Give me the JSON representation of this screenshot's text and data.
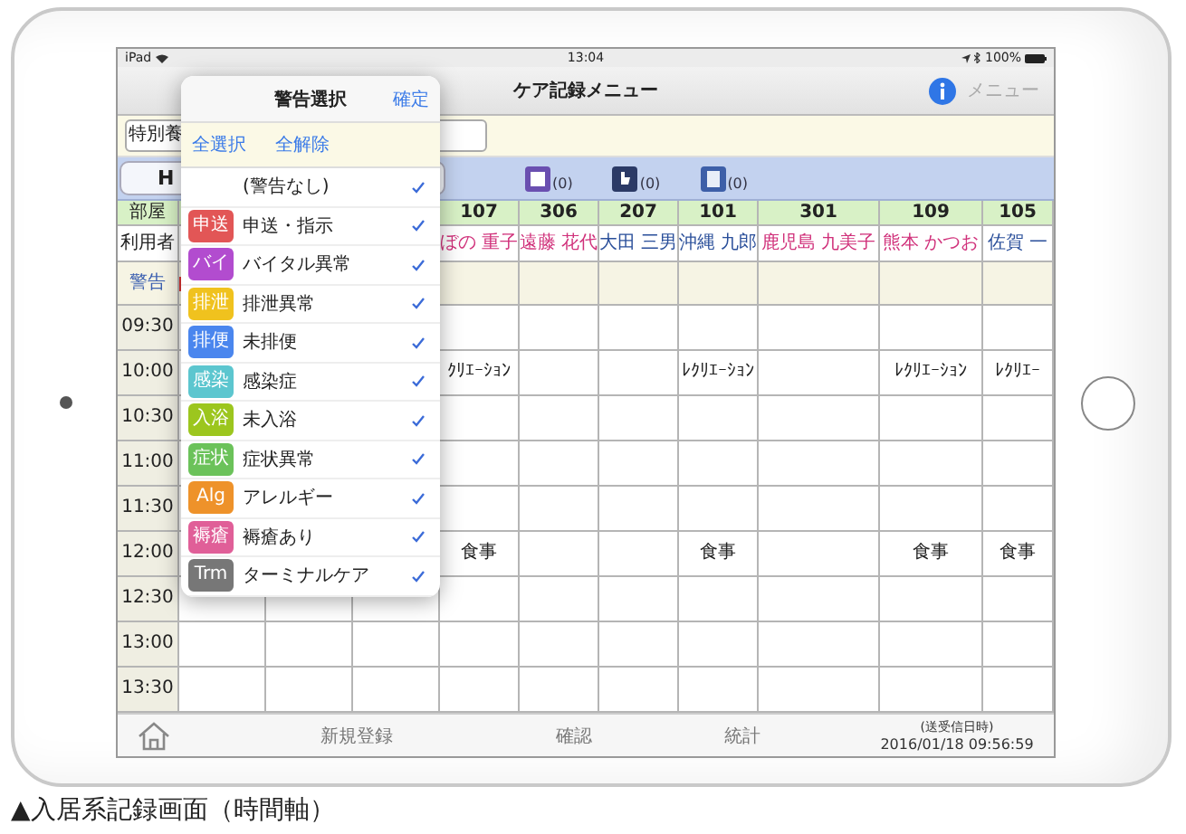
{
  "status_bar": {
    "carrier": "iPad",
    "time": "13:04",
    "battery": "100%"
  },
  "nav": {
    "title": "ケア記録メニュー",
    "menu": "メニュー"
  },
  "filter": {
    "value": "特別養"
  },
  "toolbar": {
    "button": "H",
    "counters": [
      {
        "kind": "note",
        "count": "(0)"
      },
      {
        "kind": "hand",
        "count": "(0)"
      },
      {
        "kind": "document",
        "count": "(0)"
      }
    ]
  },
  "table": {
    "room_label": "部屋",
    "user_label": "利用者",
    "warning_label": "警告",
    "rooms": [
      {
        "room": "107",
        "name": "ぼの 重子",
        "color": "#d0307a"
      },
      {
        "room": "306",
        "name": "遠藤 花代",
        "color": "#d0307a"
      },
      {
        "room": "207",
        "name": "大田 三男",
        "color": "#2a4f9a"
      },
      {
        "room": "101",
        "name": "沖縄 九郎",
        "color": "#2a4f9a"
      },
      {
        "room": "301",
        "name": "鹿児島 九美子",
        "color": "#d0307a"
      },
      {
        "room": "109",
        "name": "熊本 かつお",
        "color": "#d0307a"
      },
      {
        "room": "105",
        "name": "佐賀 一",
        "color": "#2a4f9a"
      }
    ],
    "rows": [
      {
        "time": "09:30",
        "cells": [
          {},
          {},
          {},
          {},
          {},
          {},
          {}
        ]
      },
      {
        "time": "10:00",
        "cells": [
          {
            "text": "ｸﾘｴｰｼｮﾝ"
          },
          {},
          {},
          {
            "text": "ﾚｸﾘｴｰｼｮﾝ"
          },
          {},
          {
            "text": "ﾚｸﾘｴｰｼｮﾝ"
          },
          {
            "text": "ﾚｸﾘｴｰ"
          }
        ]
      },
      {
        "time": "10:30",
        "cells": [
          {},
          {},
          {},
          {},
          {},
          {},
          {}
        ]
      },
      {
        "time": "11:00",
        "cells": [
          {},
          {},
          {},
          {},
          {},
          {},
          {}
        ]
      },
      {
        "time": "11:30",
        "cells": [
          {},
          {},
          {},
          {},
          {},
          {},
          {}
        ]
      },
      {
        "time": "12:00",
        "cells": [
          {
            "text": "食事"
          },
          {},
          {},
          {
            "text": "食事"
          },
          {},
          {
            "text": "食事"
          },
          {
            "text": "食事"
          }
        ]
      },
      {
        "time": "12:30",
        "cells": [
          {},
          {},
          {},
          {},
          {},
          {},
          {}
        ]
      },
      {
        "time": "13:00",
        "cells": [
          {},
          {},
          {},
          {},
          {},
          {},
          {}
        ]
      },
      {
        "time": "13:30",
        "cells": [
          {},
          {},
          {},
          {},
          {},
          {},
          {}
        ]
      }
    ]
  },
  "popover": {
    "title": "警告選択",
    "confirm": "確定",
    "select_all": "全選択",
    "clear_all": "全解除",
    "items": [
      {
        "label": "(警告なし)",
        "checked": true
      },
      {
        "badge": "申送",
        "label": "申送・指示",
        "color": "#e25656",
        "checked": true
      },
      {
        "badge": "バイ",
        "label": "バイタル異常",
        "color": "#b24ccf",
        "checked": true
      },
      {
        "badge": "排泄",
        "label": "排泄異常",
        "color": "#f0c21e",
        "checked": true
      },
      {
        "badge": "排便",
        "label": "未排便",
        "color": "#4a86ee",
        "checked": true
      },
      {
        "badge": "感染",
        "label": "感染症",
        "color": "#5cc6cf",
        "checked": true
      },
      {
        "badge": "入浴",
        "label": "未入浴",
        "color": "#9cc61e",
        "checked": true
      },
      {
        "badge": "症状",
        "label": "症状異常",
        "color": "#6bc25a",
        "checked": true
      },
      {
        "badge": "Alg",
        "label": "アレルギー",
        "color": "#ee922a",
        "checked": true
      },
      {
        "badge": "褥瘡",
        "label": "褥瘡あり",
        "color": "#e05f98",
        "checked": true
      },
      {
        "badge": "Trm",
        "label": "ターミナルケア",
        "color": "#777777",
        "checked": true
      }
    ]
  },
  "bottom_bar": {
    "actions": [
      "新規登録",
      "確認",
      "統計"
    ],
    "sync_label": "(送受信日時)",
    "sync_time": "2016/01/18 09:56:59"
  },
  "caption": "▲入居系記録画面（時間軸）"
}
